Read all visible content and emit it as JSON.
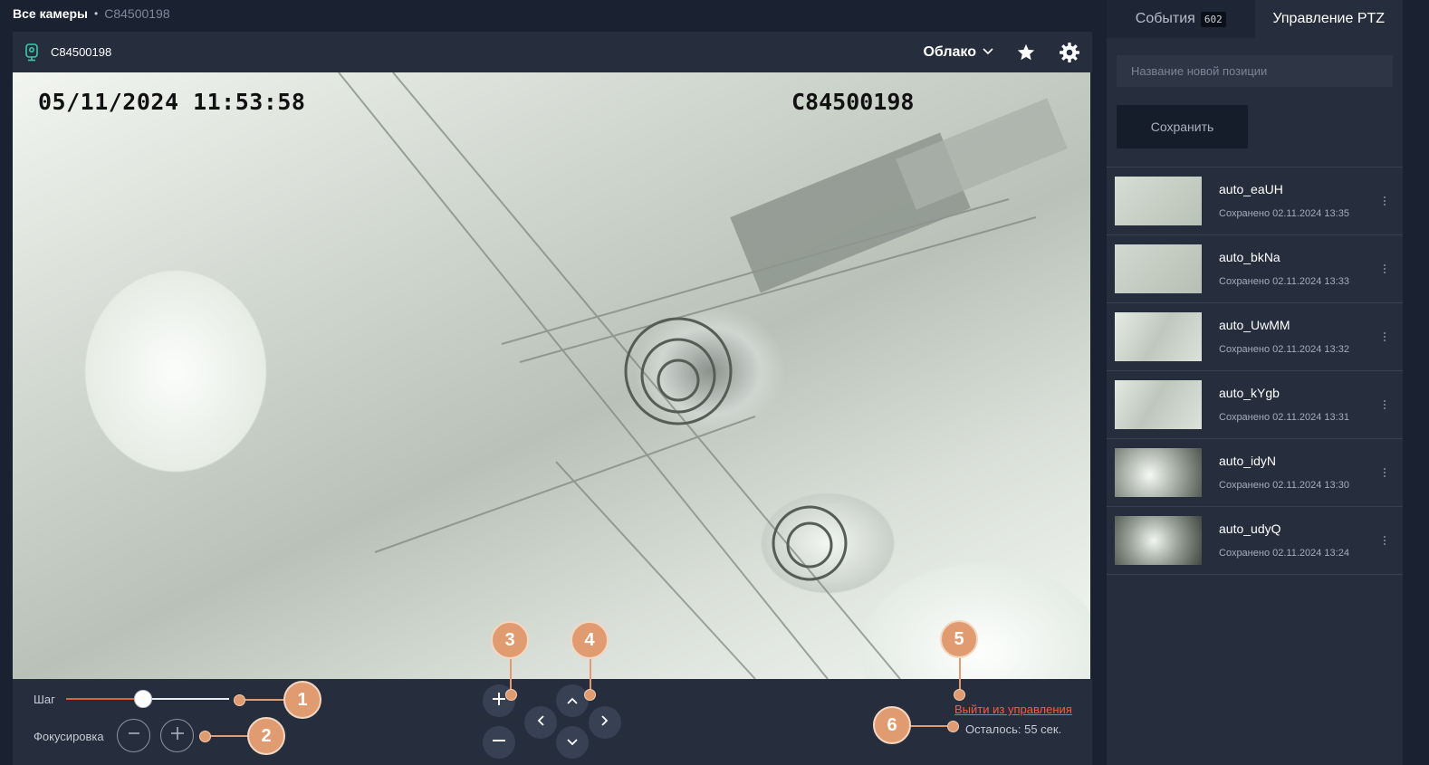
{
  "breadcrumb": {
    "root": "Все камеры",
    "separator": "•",
    "current": "C84500198"
  },
  "camera": {
    "name": "C84500198",
    "storage_label": "Облако"
  },
  "video": {
    "timestamp": "05/11/2024 11:53:58",
    "overlay_id": "C84500198"
  },
  "controls": {
    "step_label": "Шаг",
    "step_value": 0.47,
    "focus_label": "Фокусировка",
    "exit_label": "Выйти из управления",
    "remaining_label": "Осталось: 55 сек."
  },
  "annotations": [
    "1",
    "2",
    "3",
    "4",
    "5",
    "6"
  ],
  "tabs": [
    {
      "label": "События",
      "badge": "602"
    },
    {
      "label": "Управление PTZ"
    }
  ],
  "ptz_panel": {
    "position_placeholder": "Название новой позиции",
    "save_label": "Сохранить",
    "positions": [
      {
        "name": "auto_eaUH",
        "saved": "Сохранено 02.11.2024 13:35"
      },
      {
        "name": "auto_bkNa",
        "saved": "Сохранено 02.11.2024 13:33"
      },
      {
        "name": "auto_UwMM",
        "saved": "Сохранено 02.11.2024 13:32"
      },
      {
        "name": "auto_kYgb",
        "saved": "Сохранено 02.11.2024 13:31"
      },
      {
        "name": "auto_idyN",
        "saved": "Сохранено 02.11.2024 13:30"
      },
      {
        "name": "auto_udyQ",
        "saved": "Сохранено 02.11.2024 13:24"
      }
    ]
  },
  "colors": {
    "accent": "#e09c70",
    "link": "#ff5a3c",
    "slider_fill": "#e0603a",
    "panel_bg": "#262e3d",
    "page_bg": "#1a2130"
  }
}
